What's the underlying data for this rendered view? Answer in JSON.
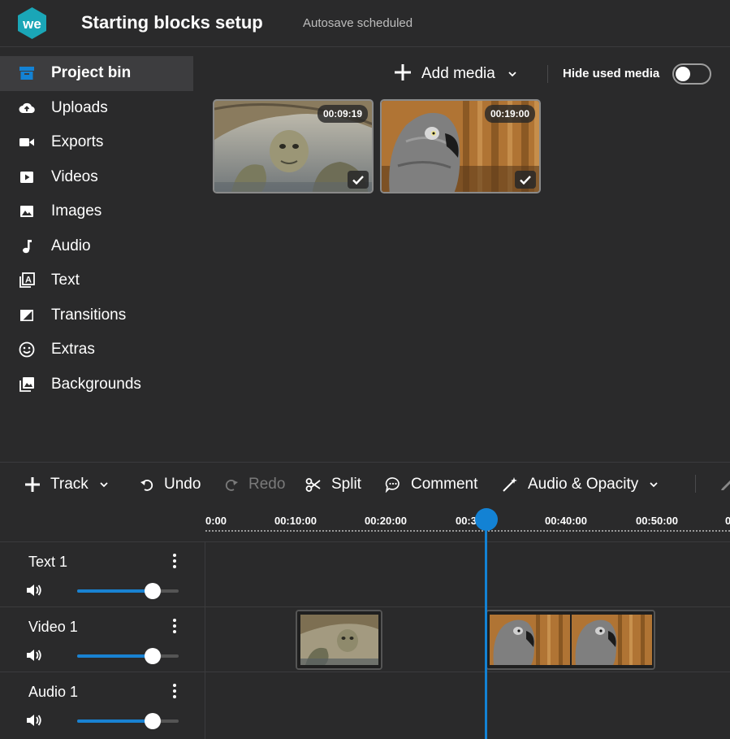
{
  "header": {
    "title": "Starting blocks setup",
    "autosave_status": "Autosave scheduled",
    "logo_text": "we"
  },
  "sidebar": {
    "items": [
      {
        "label": "Project bin",
        "icon": "archive-box-icon",
        "active": true
      },
      {
        "label": "Uploads",
        "icon": "cloud-upload-icon"
      },
      {
        "label": "Exports",
        "icon": "video-camera-icon"
      },
      {
        "label": "Videos",
        "icon": "play-square-icon"
      },
      {
        "label": "Images",
        "icon": "image-icon"
      },
      {
        "label": "Audio",
        "icon": "music-note-icon"
      },
      {
        "label": "Text",
        "icon": "text-layers-icon"
      },
      {
        "label": "Transitions",
        "icon": "transition-icon"
      },
      {
        "label": "Extras",
        "icon": "smiley-icon"
      },
      {
        "label": "Backgrounds",
        "icon": "stacked-images-icon"
      }
    ]
  },
  "media_toolbar": {
    "add_media_label": "Add media",
    "hide_used_label": "Hide used media",
    "hide_used_enabled": false
  },
  "media": [
    {
      "subject": "tortoise",
      "duration": "00:09:19",
      "used": true
    },
    {
      "subject": "parrot",
      "duration": "00:19:00",
      "used": true
    }
  ],
  "timeline_toolbar": {
    "track_label": "Track",
    "undo_label": "Undo",
    "redo_label": "Redo",
    "split_label": "Split",
    "comment_label": "Comment",
    "audio_opacity_label": "Audio & Opacity"
  },
  "ruler": {
    "ticks": [
      "0:00",
      "00:10:00",
      "00:20:00",
      "00:30:00",
      "00:40:00",
      "00:50:00",
      "0"
    ],
    "playhead_time": "00:30:00"
  },
  "tracks": [
    {
      "name": "Text 1",
      "volume_percent": 74
    },
    {
      "name": "Video 1",
      "volume_percent": 74
    },
    {
      "name": "Audio 1",
      "volume_percent": 74
    }
  ],
  "colors": {
    "background": "#2a2a2b",
    "accent": "#1382d4",
    "logo": "#1aa6b7"
  }
}
